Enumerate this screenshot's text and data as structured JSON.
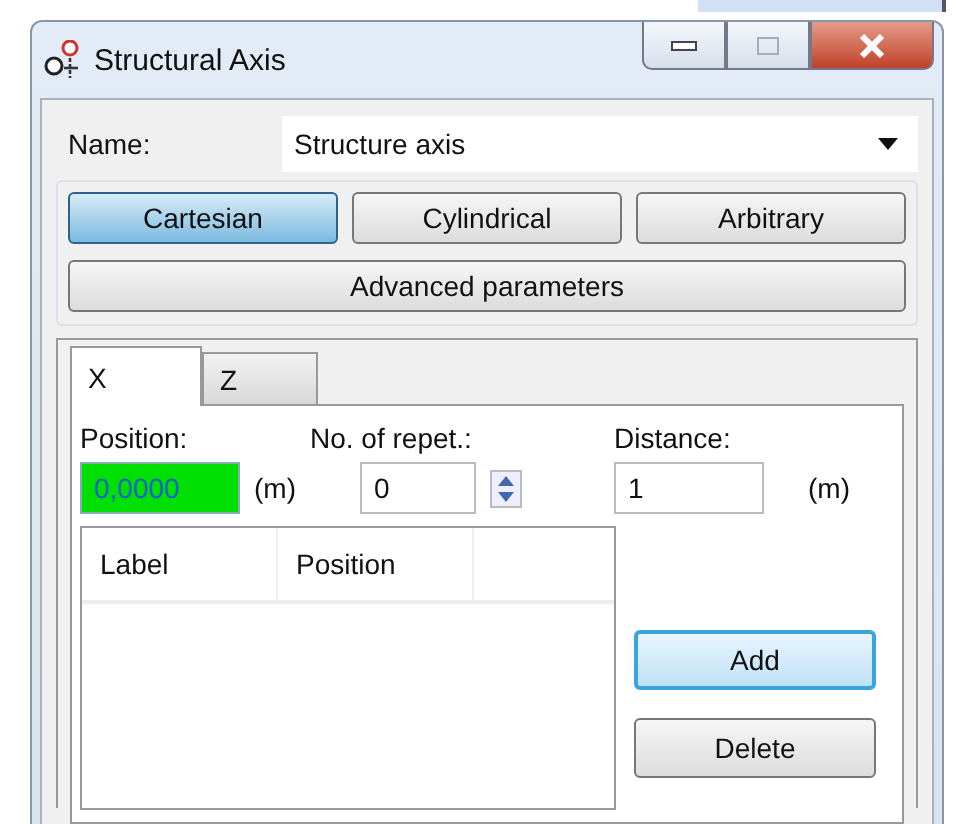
{
  "window": {
    "title": "Structural Axis"
  },
  "name": {
    "label": "Name:",
    "value": "Structure axis"
  },
  "coordinate_types": [
    {
      "label": "Cartesian",
      "selected": true
    },
    {
      "label": "Cylindrical",
      "selected": false
    },
    {
      "label": "Arbitrary",
      "selected": false
    }
  ],
  "advanced_button": "Advanced parameters",
  "tabs": [
    {
      "label": "X",
      "selected": true
    },
    {
      "label": "Z",
      "selected": false
    }
  ],
  "position": {
    "label": "Position:",
    "value": "0,0000",
    "highlighted": true,
    "unit": "(m)"
  },
  "repetitions": {
    "label": "No. of repet.:",
    "value": "0"
  },
  "distance": {
    "label": "Distance:",
    "value": "1",
    "unit": "(m)"
  },
  "table": {
    "columns": [
      "Label",
      "Position"
    ]
  },
  "buttons": [
    {
      "label": "Add",
      "default": true
    },
    {
      "label": "Delete",
      "default": false
    }
  ]
}
